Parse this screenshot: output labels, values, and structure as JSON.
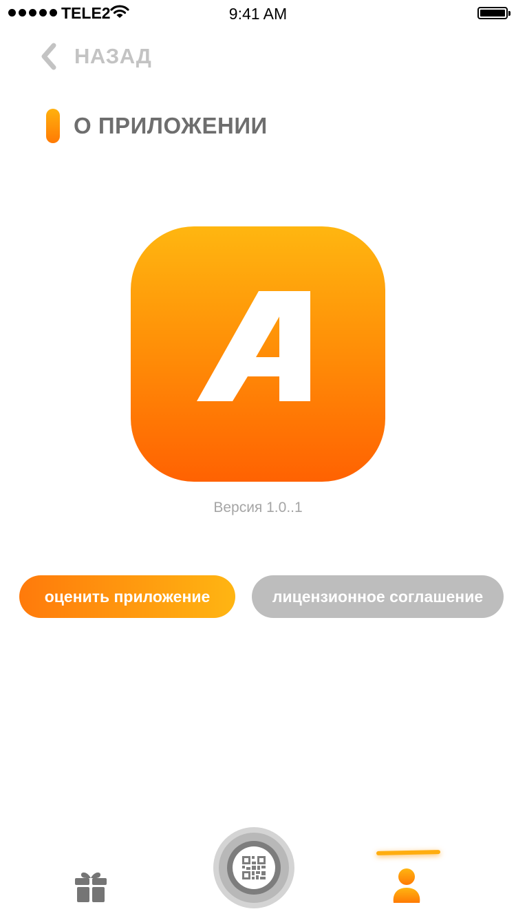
{
  "status_bar": {
    "carrier": "TELE2",
    "time": "9:41 AM"
  },
  "header": {
    "back_label": "НАЗАД",
    "title": "О ПРИЛОЖЕНИИ"
  },
  "app": {
    "icon_letter": "A",
    "version": "Версия 1.0..1"
  },
  "buttons": {
    "rate_label": "оценить приложение",
    "license_label": "лицензионное соглашение"
  },
  "tab_bar": {
    "tabs": [
      {
        "icon": "gift-icon",
        "active": false
      },
      {
        "icon": "qr-code-icon",
        "active": false
      },
      {
        "icon": "user-icon",
        "active": true
      }
    ]
  },
  "colors": {
    "accent_light": "#ffb512",
    "accent_dark": "#ff6202",
    "muted_gray": "#bdbdbd",
    "title_gray": "#6e6e6e"
  }
}
